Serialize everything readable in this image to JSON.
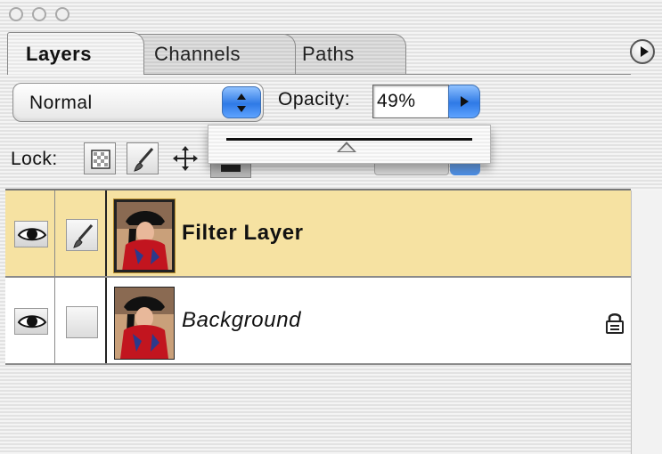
{
  "tabs": [
    {
      "label": "Layers",
      "active": true
    },
    {
      "label": "Channels",
      "active": false
    },
    {
      "label": "Paths",
      "active": false
    }
  ],
  "blend_mode": {
    "value": "Normal"
  },
  "opacity": {
    "label": "Opacity:",
    "value": "49%",
    "slider_level_percent": 49
  },
  "lock": {
    "label": "Lock:"
  },
  "layers": [
    {
      "name": "Filter Layer",
      "selected": true,
      "visible": true,
      "locked": false
    },
    {
      "name": "Background",
      "selected": false,
      "visible": true,
      "locked": true
    }
  ],
  "colors": {
    "selected_row": "#f6e2a2",
    "accent_blue": "#2f7ae6"
  },
  "icons": [
    "window-close-icon",
    "window-minimize-icon",
    "window-zoom-icon",
    "panel-menu-arrow-icon",
    "up-down-arrows-icon",
    "right-arrow-icon",
    "lock-transparency-icon",
    "lock-image-brush-icon",
    "lock-position-move-icon",
    "eye-icon",
    "brush-icon",
    "lock-icon"
  ]
}
